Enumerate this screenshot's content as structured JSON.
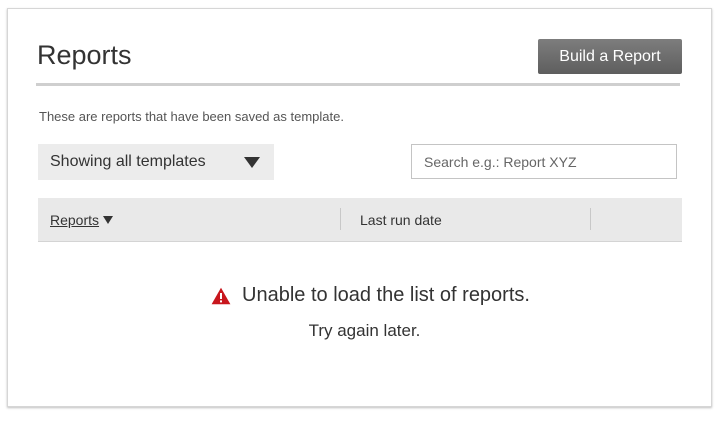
{
  "header": {
    "title": "Reports",
    "build_button_label": "Build a Report"
  },
  "description": "These are reports that have been saved as template.",
  "filter": {
    "selected": "Showing all templates"
  },
  "search": {
    "placeholder": "Search e.g.: Report XYZ",
    "value": ""
  },
  "table": {
    "columns": [
      {
        "label": "Reports",
        "sorted": "descending"
      },
      {
        "label": "Last run date"
      },
      {
        "label": ""
      }
    ]
  },
  "error": {
    "message": "Unable to load the list of reports.",
    "retry": "Try again later.",
    "icon": "warning-icon",
    "icon_color": "#c8161d"
  },
  "colors": {
    "button_bg": "#6e6e6e",
    "table_header_bg": "#e9e9e9",
    "select_bg": "#ececec"
  }
}
